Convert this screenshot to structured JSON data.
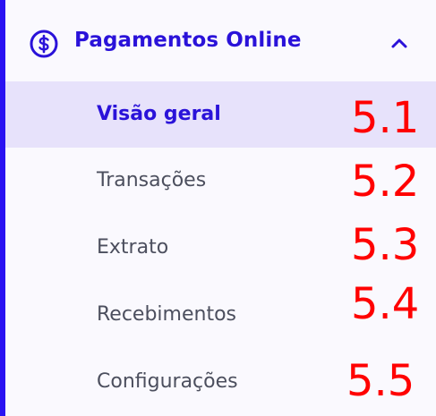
{
  "menu": {
    "header": {
      "label": "Pagamentos Online",
      "icon": "dollar-circle-icon",
      "toggle_icon": "chevron-up-icon",
      "expanded": true
    },
    "accent_color": "#2a12f2",
    "items": [
      {
        "label": "Visão geral",
        "active": true,
        "annotation": "5.1"
      },
      {
        "label": "Transações",
        "active": false,
        "annotation": "5.2"
      },
      {
        "label": "Extrato",
        "active": false,
        "annotation": "5.3"
      },
      {
        "label": "Recebimentos",
        "active": false,
        "annotation": "5.4"
      },
      {
        "label": "Configurações",
        "active": false,
        "annotation": "5.5"
      }
    ]
  }
}
